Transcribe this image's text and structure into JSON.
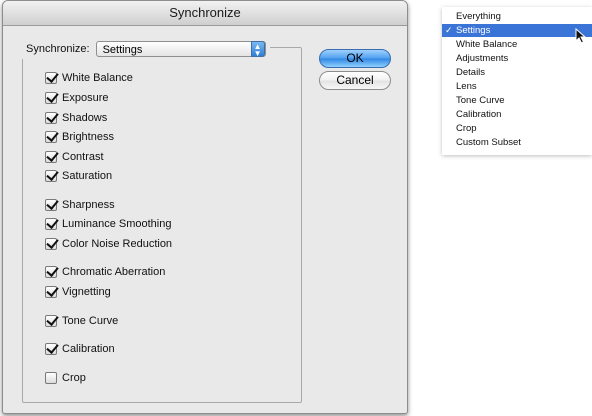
{
  "dialog": {
    "title": "Synchronize",
    "sync_label": "Synchronize:",
    "sync_value": "Settings",
    "ok_label": "OK",
    "cancel_label": "Cancel",
    "checkboxes": [
      {
        "label": "White Balance",
        "checked": true
      },
      {
        "label": "Exposure",
        "checked": true
      },
      {
        "label": "Shadows",
        "checked": true
      },
      {
        "label": "Brightness",
        "checked": true
      },
      {
        "label": "Contrast",
        "checked": true
      },
      {
        "label": "Saturation",
        "checked": true
      },
      {
        "label": "Sharpness",
        "checked": true
      },
      {
        "label": "Luminance Smoothing",
        "checked": true
      },
      {
        "label": "Color Noise Reduction",
        "checked": true
      },
      {
        "label": "Chromatic Aberration",
        "checked": true
      },
      {
        "label": "Vignetting",
        "checked": true
      },
      {
        "label": "Tone Curve",
        "checked": true
      },
      {
        "label": "Calibration",
        "checked": true
      },
      {
        "label": "Crop",
        "checked": false
      }
    ]
  },
  "menu": {
    "checkmark": "✓",
    "items": [
      {
        "label": "Everything",
        "selected": false
      },
      {
        "label": "Settings",
        "selected": true
      },
      {
        "label": "White Balance",
        "selected": false
      },
      {
        "label": "Adjustments",
        "selected": false
      },
      {
        "label": "Details",
        "selected": false
      },
      {
        "label": "Lens",
        "selected": false
      },
      {
        "label": "Tone Curve",
        "selected": false
      },
      {
        "label": "Calibration",
        "selected": false
      },
      {
        "label": "Crop",
        "selected": false
      },
      {
        "label": "Custom Subset",
        "selected": false
      }
    ]
  },
  "colors": {
    "selection": "#3b74d7",
    "dialog_bg": "#e9e9e9",
    "ok_button": "#4f9fef"
  }
}
